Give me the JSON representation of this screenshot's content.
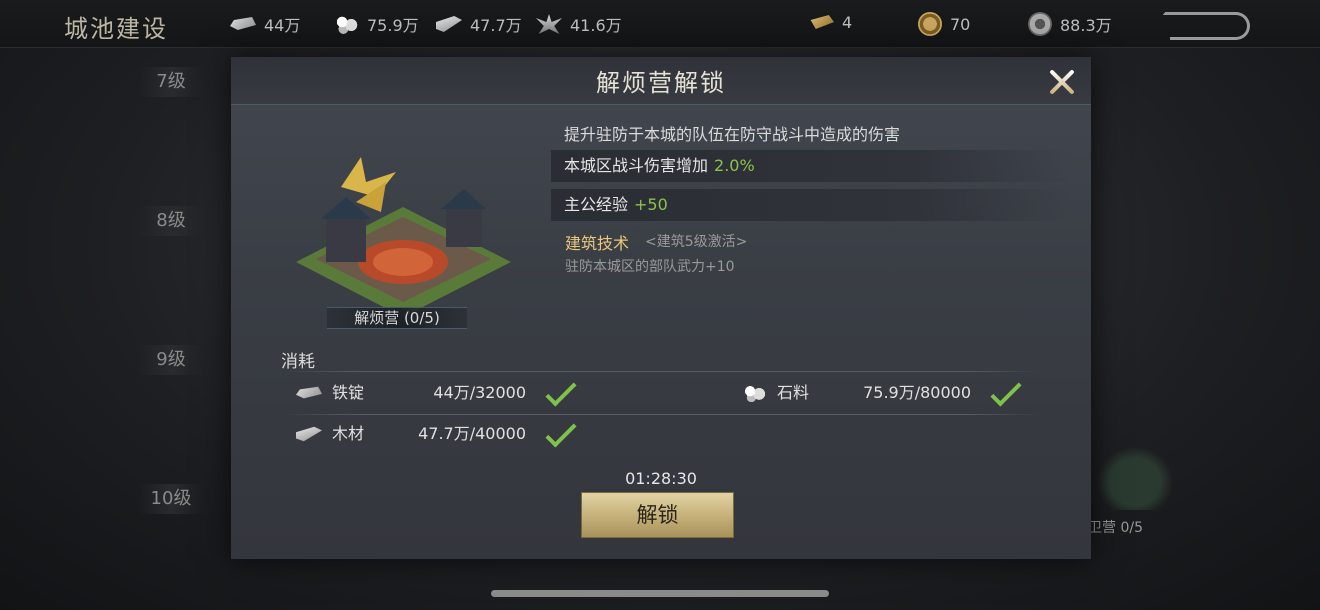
{
  "topbar": {
    "title": "城池建设",
    "resources": [
      {
        "icon": "ingot-icon",
        "value": "44万"
      },
      {
        "icon": "stone-icon",
        "value": "75.9万"
      },
      {
        "icon": "wood-icon",
        "value": "47.7万"
      },
      {
        "icon": "grain-icon",
        "value": "41.6万"
      }
    ],
    "currencies": [
      {
        "icon": "gold-ingot-icon",
        "value": "4"
      },
      {
        "icon": "copper-coin-icon",
        "value": "70"
      },
      {
        "icon": "silver-coin-icon",
        "value": "88.3万"
      }
    ]
  },
  "background": {
    "levels": [
      "7级",
      "8级",
      "9级",
      "10级"
    ],
    "building_label": "卫营 0/5"
  },
  "modal": {
    "title": "解烦营解锁",
    "building_name": "解烦营 (0/5)",
    "description": "提升驻防于本城的队伍在防守战斗中造成的伤害",
    "stats": [
      {
        "label": "本城区战斗伤害增加",
        "value": "2.0%"
      },
      {
        "label": "主公经验",
        "value": "+50"
      }
    ],
    "tech": {
      "title": "建筑技术",
      "note": "<建筑5级激活>",
      "effect": "驻防本城区的部队武力+10"
    },
    "consume_title": "消耗",
    "costs": [
      {
        "icon": "ingot-icon",
        "name": "铁锭",
        "amount": "44万/32000",
        "met": true
      },
      {
        "icon": "stone-icon",
        "name": "石料",
        "amount": "75.9万/80000",
        "met": true
      },
      {
        "icon": "wood-icon",
        "name": "木材",
        "amount": "47.7万/40000",
        "met": true
      }
    ],
    "timer": "01:28:30",
    "unlock_label": "解锁"
  },
  "colors": {
    "accent_gold": "#e8c87a",
    "positive_green": "#8bc34a",
    "button_gold": "#c6b27a"
  }
}
